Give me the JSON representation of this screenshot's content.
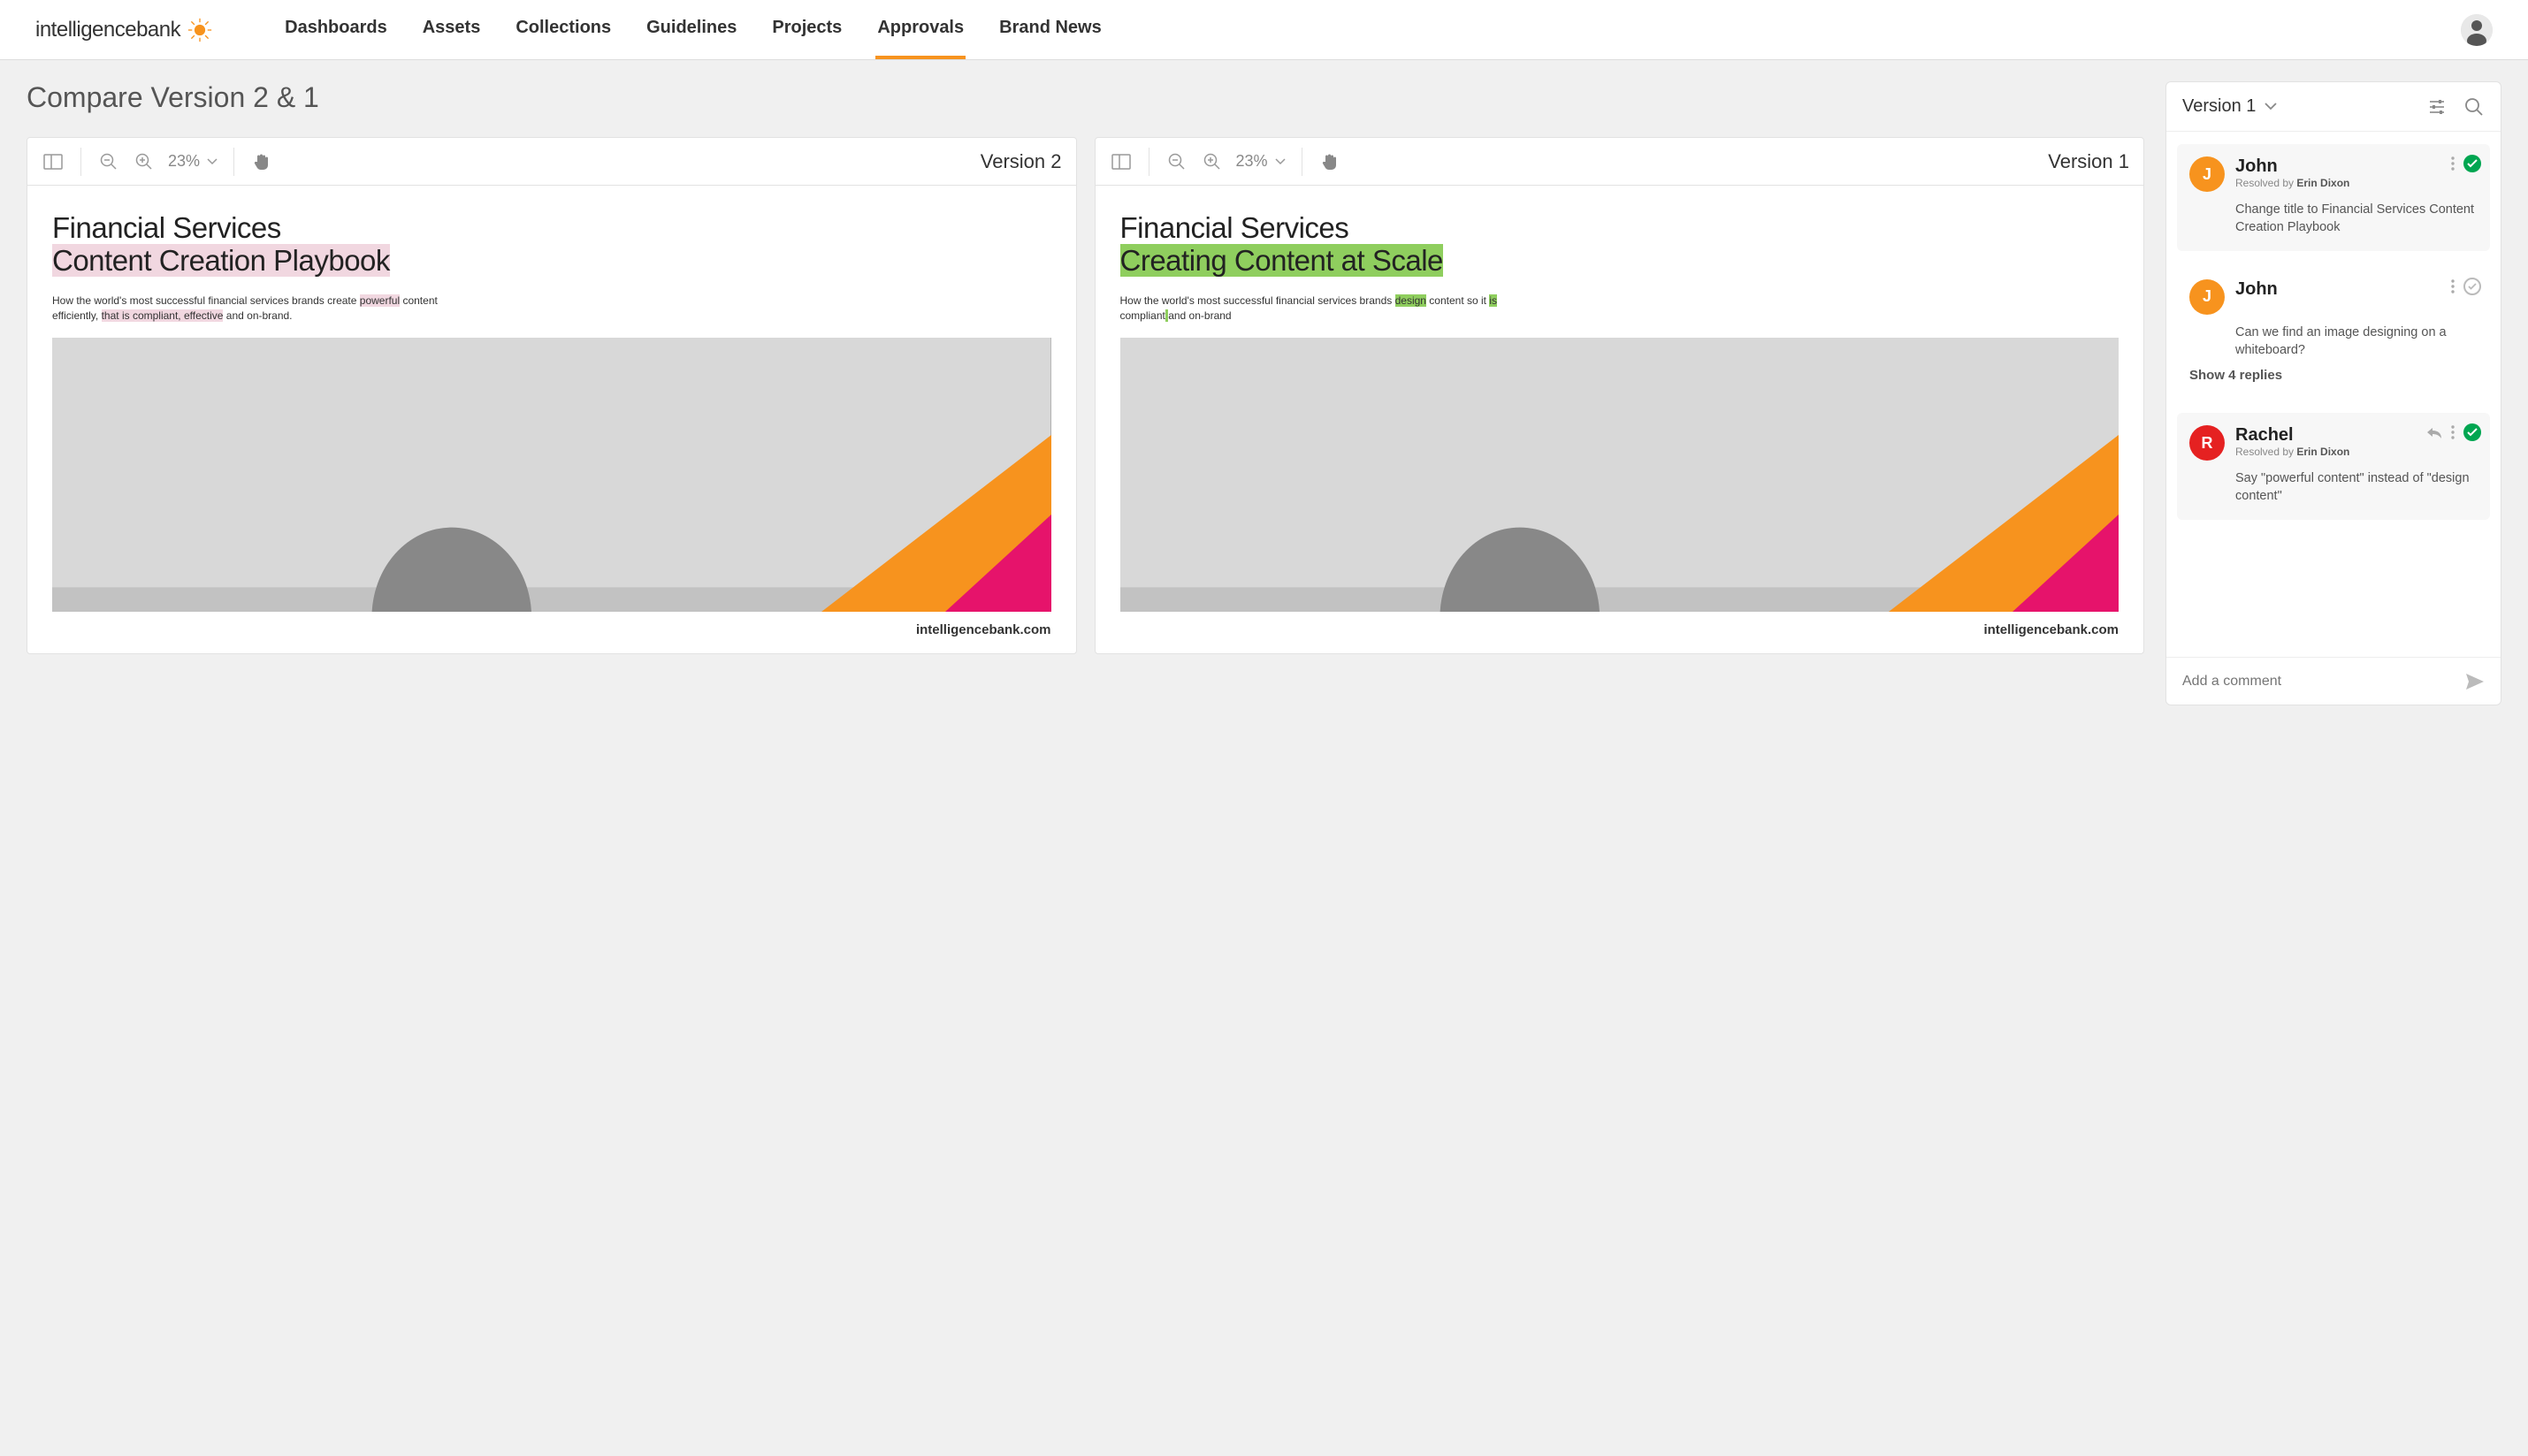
{
  "brand": {
    "name": "intelligencebank"
  },
  "nav": {
    "items": [
      {
        "label": "Dashboards"
      },
      {
        "label": "Assets"
      },
      {
        "label": "Collections"
      },
      {
        "label": "Guidelines"
      },
      {
        "label": "Projects"
      },
      {
        "label": "Approvals"
      },
      {
        "label": "Brand News"
      }
    ],
    "active_index": 5
  },
  "page_title": "Compare Version 2 & 1",
  "panels": {
    "left": {
      "zoom": "23%",
      "version_label": "Version 2",
      "doc": {
        "title_line1": "Financial Services",
        "title_line2": "Content Creation Playbook",
        "sub_pre": "How the world's most successful financial services brands create ",
        "sub_hl1": "powerful",
        "sub_mid": " content efficiently, ",
        "sub_hl2": "that is compliant, effective",
        "sub_post": " and on-brand.",
        "footer": "intelligencebank.com"
      }
    },
    "right": {
      "zoom": "23%",
      "version_label": "Version 1",
      "doc": {
        "title_line1": "Financial Services",
        "title_line2": "Creating Content at Scale",
        "sub_pre": "How the world's most successful financial services brands ",
        "sub_hl1": "design",
        "sub_mid": " content so it ",
        "sub_hl2": "is",
        "sub_mid2": " compliant",
        "sub_hl3": " ",
        "sub_post": "and on-brand",
        "footer": "intelligencebank.com"
      }
    }
  },
  "sidebar": {
    "version_selector": "Version 1",
    "comments": [
      {
        "avatar_initial": "J",
        "avatar_color": "orange",
        "name": "John",
        "resolved_by": "Erin Dixon",
        "text": "Change title to Financial Services Content Creation Playbook",
        "status": "resolved",
        "card": true
      },
      {
        "avatar_initial": "J",
        "avatar_color": "orange",
        "name": "John",
        "text": "Can we find an image designing on a whiteboard?",
        "status": "open",
        "card": false,
        "replies_label": "Show 4 replies"
      },
      {
        "avatar_initial": "R",
        "avatar_color": "red",
        "name": "Rachel",
        "resolved_by": "Erin Dixon",
        "text": "Say \"powerful content\" instead of \"design content\"",
        "status": "resolved",
        "card": true,
        "reply_icon": true
      }
    ],
    "input_placeholder": "Add a comment"
  },
  "icons": {
    "layout": "layout-columns-icon",
    "zoom_out": "zoom-out-icon",
    "zoom_in": "zoom-in-icon",
    "hand": "hand-icon",
    "sliders": "sliders-icon",
    "search": "search-icon",
    "more": "more-vertical-icon",
    "check": "check-icon",
    "reply": "reply-icon",
    "send": "send-icon",
    "chevron": "chevron-down-icon"
  }
}
